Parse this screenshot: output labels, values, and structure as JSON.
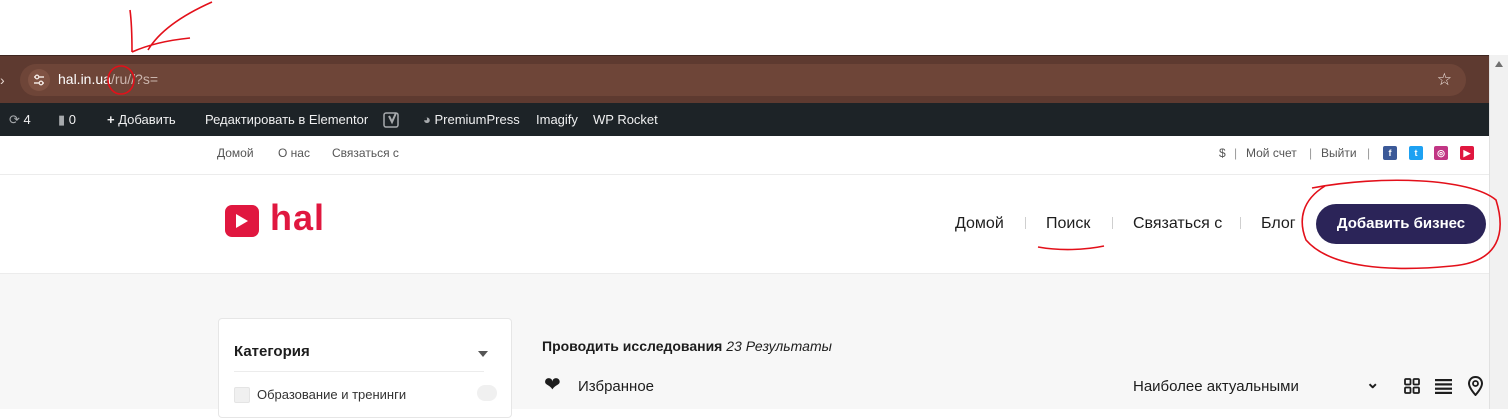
{
  "browser": {
    "url_domain": "hal.in.ua",
    "url_rest": "/ru//?s="
  },
  "admin_bar": {
    "updates_count": "4",
    "comments_count": "0",
    "add_label": "Добавить",
    "edit_elementor_label": "Редактировать в Elementor",
    "premiumpress_label": "PremiumPress",
    "imagify_label": "Imagify",
    "wp_rocket_label": "WP Rocket"
  },
  "top_nav": {
    "links": [
      "Домой",
      "О нас",
      "Связаться с"
    ],
    "currency": "$",
    "account": "Мой счет",
    "logout": "Выйти",
    "social": [
      "facebook",
      "twitter",
      "instagram",
      "youtube"
    ],
    "social_colors": [
      "#3b5998",
      "#1da1f2",
      "#c13584",
      "#e0173f"
    ]
  },
  "header": {
    "logo_text": "hal",
    "nav": [
      "Домой",
      "Поиск",
      "Связаться с",
      "Блог"
    ],
    "cta": "Добавить бизнес",
    "brand_color": "#e0173f",
    "cta_color": "#2b2458"
  },
  "sidebar": {
    "title": "Категория",
    "first_category": "Образование и тренинги"
  },
  "results": {
    "label": "Проводить исследования",
    "count": "23 Результаты",
    "favorites": "Избранное",
    "sort": "Наиболее актуальными"
  }
}
